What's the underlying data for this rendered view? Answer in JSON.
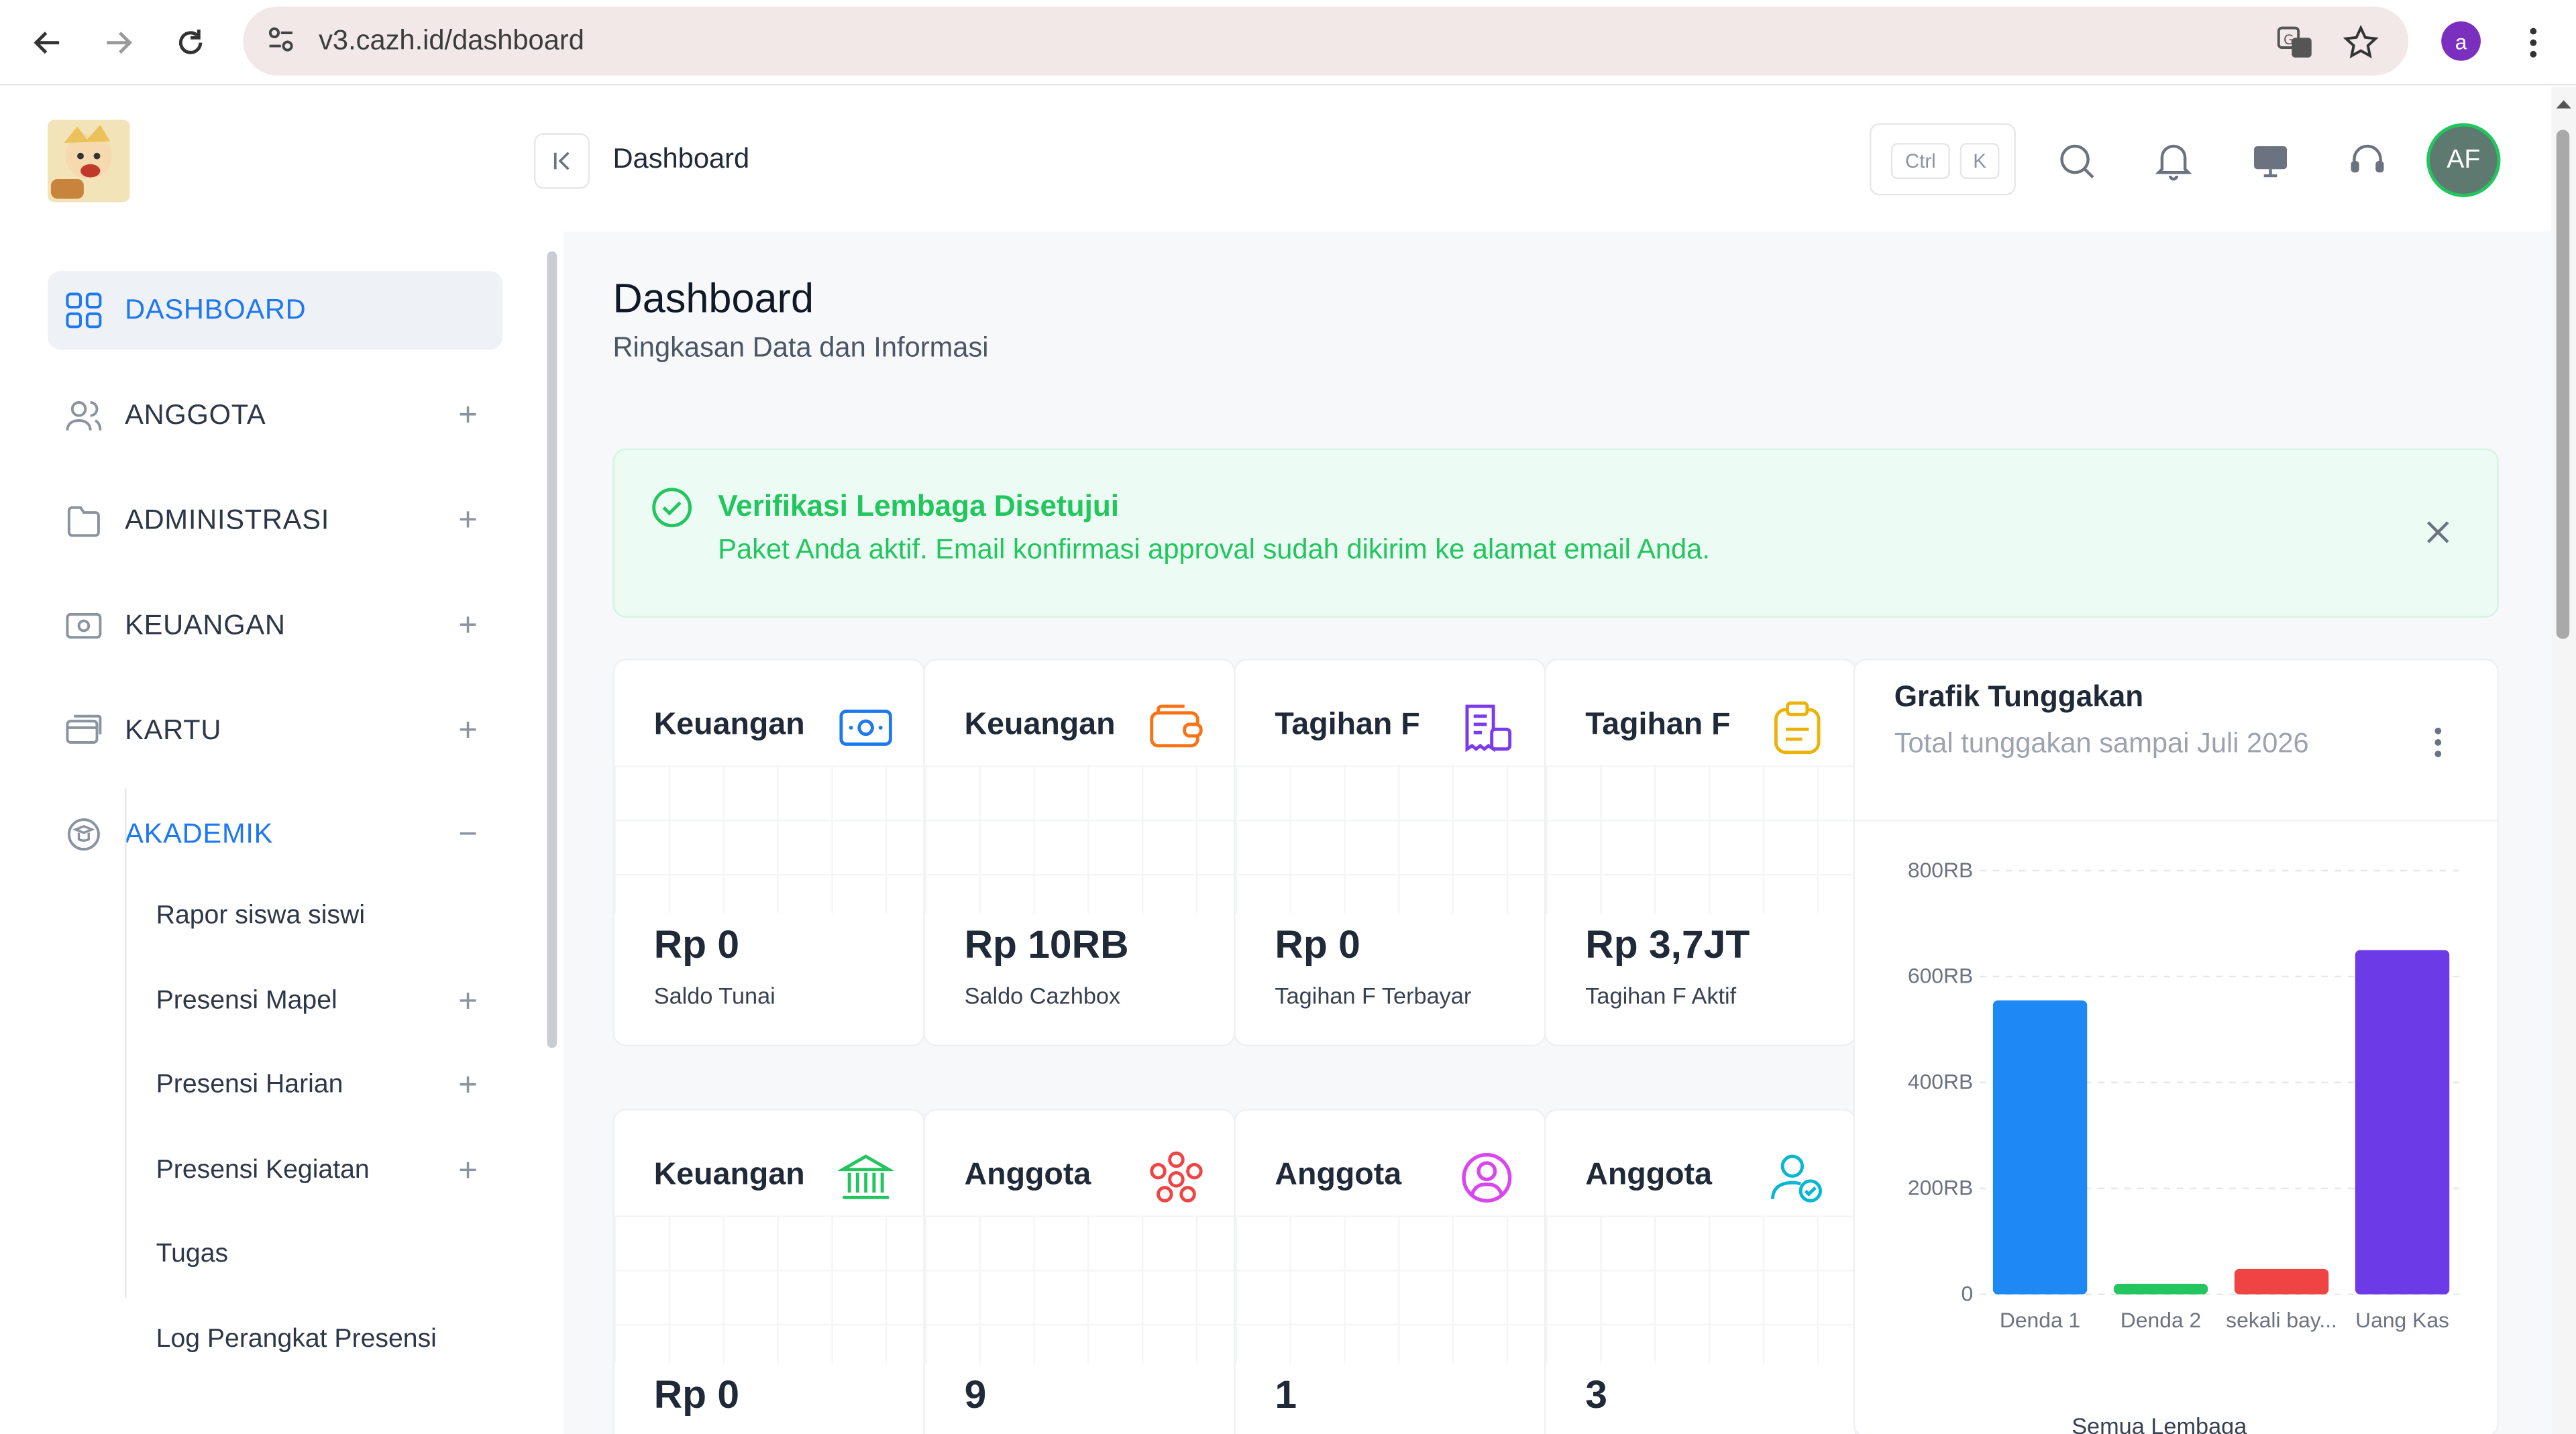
{
  "browser": {
    "url": "v3.cazh.id/dashboard",
    "profile_initial": "a"
  },
  "sidebar": {
    "items": [
      {
        "label": "DASHBOARD",
        "icon": "grid-icon"
      },
      {
        "label": "ANGGOTA",
        "icon": "users-icon",
        "expand": "+"
      },
      {
        "label": "ADMINISTRASI",
        "icon": "folder-icon",
        "expand": "+"
      },
      {
        "label": "KEUANGAN",
        "icon": "money-icon",
        "expand": "+"
      },
      {
        "label": "KARTU",
        "icon": "card-icon",
        "expand": "+"
      },
      {
        "label": "AKADEMIK",
        "icon": "academic-icon",
        "expand": "−"
      }
    ],
    "subitems": [
      {
        "label": "Rapor siswa siswi"
      },
      {
        "label": "Presensi Mapel",
        "expand": "+"
      },
      {
        "label": "Presensi Harian",
        "expand": "+"
      },
      {
        "label": "Presensi Kegiatan",
        "expand": "+"
      },
      {
        "label": "Tugas"
      },
      {
        "label": "Log Perangkat Presensi"
      }
    ]
  },
  "header": {
    "breadcrumb": "Dashboard",
    "kbd_ctrl": "Ctrl",
    "kbd_k": "K",
    "avatar": "AF"
  },
  "page": {
    "title": "Dashboard",
    "subtitle": "Ringkasan Data dan Informasi"
  },
  "alert": {
    "title": "Verifikasi Lembaga Disetujui",
    "message": "Paket Anda aktif. Email konfirmasi approval sudah dikirim ke alamat email Anda."
  },
  "cards_row1": [
    {
      "title": "Keuangan",
      "value": "Rp 0",
      "label": "Saldo Tunai",
      "icon": "money-icon",
      "color": "#1e78ef"
    },
    {
      "title": "Keuangan",
      "value": "Rp 10RB",
      "label": "Saldo Cazhbox",
      "icon": "wallet-icon",
      "color": "#f97316"
    },
    {
      "title": "Tagihan F",
      "value": "Rp 0",
      "label": "Tagihan F Terbayar",
      "icon": "invoice-icon",
      "color": "#7c3aed"
    },
    {
      "title": "Tagihan F",
      "value": "Rp 3,7JT",
      "label": "Tagihan F Aktif",
      "icon": "clipboard-icon",
      "color": "#eab308"
    }
  ],
  "cards_row2": [
    {
      "title": "Keuangan",
      "value": "Rp 0",
      "icon": "bank-icon",
      "color": "#22c55e"
    },
    {
      "title": "Anggota",
      "value": "9",
      "icon": "group-icon",
      "color": "#ef4444"
    },
    {
      "title": "Anggota",
      "value": "1",
      "icon": "user-circle-icon",
      "color": "#d946ef"
    },
    {
      "title": "Anggota",
      "value": "3",
      "icon": "user-check-icon",
      "color": "#06b6d4"
    }
  ],
  "chart_card": {
    "title": "Grafik Tunggakan",
    "subtitle": "Total tunggakan sampai Juli 2026",
    "footer": "Semua Lembaga"
  },
  "chart_data": {
    "type": "bar",
    "categories": [
      "Denda 1",
      "Denda 2",
      "sekali bay...",
      "Uang Kas"
    ],
    "values": [
      555000,
      20000,
      48000,
      650000
    ],
    "colors": [
      "#1e88f5",
      "#22c55e",
      "#ef4444",
      "#6d3ae8"
    ],
    "ylim": [
      0,
      800000
    ],
    "yticks": [
      0,
      200000,
      400000,
      600000,
      800000
    ],
    "yticklabels": [
      "0",
      "200RB",
      "400RB",
      "600RB",
      "800RB"
    ],
    "grid": true
  }
}
